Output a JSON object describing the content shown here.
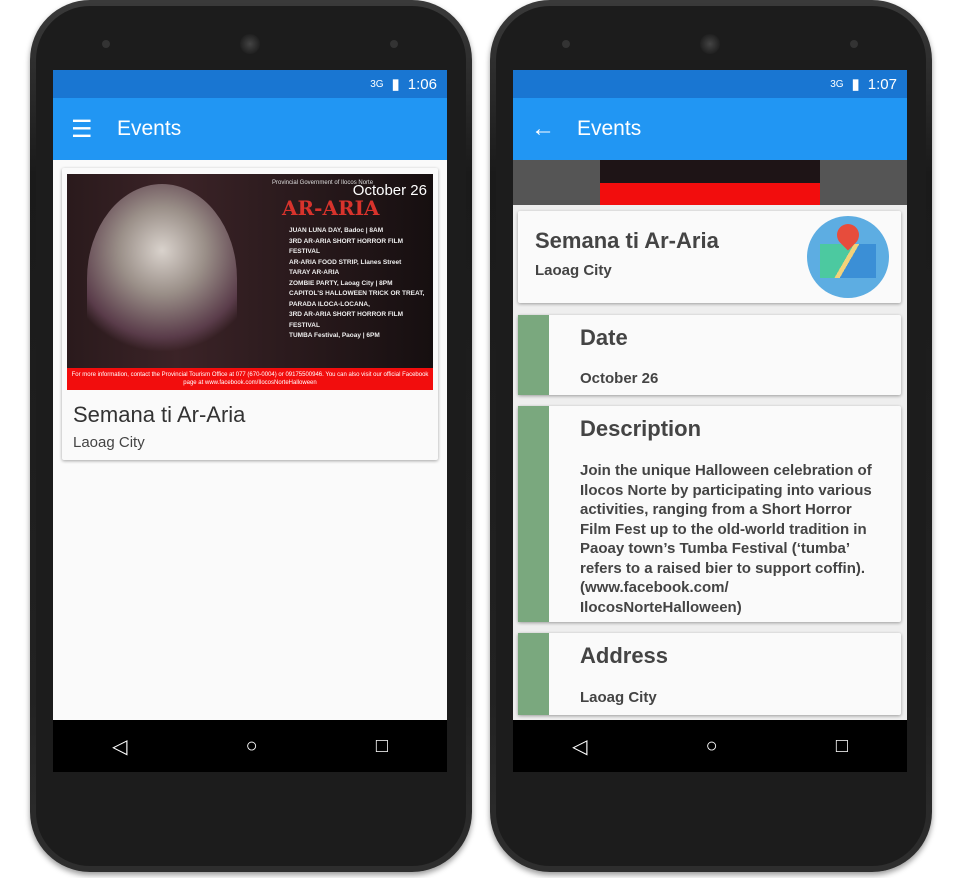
{
  "left": {
    "status": {
      "network": "3G",
      "time": "1:06"
    },
    "toolbar": {
      "title": "Events",
      "nav_icon": "menu-icon"
    },
    "event": {
      "date_overlay": "October 26",
      "title": "Semana ti Ar-Aria",
      "location": "Laoag City"
    }
  },
  "right": {
    "status": {
      "network": "3G",
      "time": "1:07"
    },
    "toolbar": {
      "title": "Events",
      "nav_icon": "back-arrow-icon"
    },
    "header": {
      "title": "Semana ti Ar-Aria",
      "location": "Laoag City"
    },
    "sections": [
      {
        "label": "Date",
        "value": "October 26"
      },
      {
        "label": "Description",
        "value": "Join the unique Halloween celebration of Ilocos Norte by participating into various activities, ranging from a Short Horror Film Fest up to the old-world tradition in Paoay town’s Tumba Festival (‘tumba’ refers to a raised bier to support coffin). (www.facebook.com/ IlocosNorteHalloween)"
      },
      {
        "label": "Address",
        "value": "Laoag City"
      }
    ]
  },
  "poster": {
    "org": "Provincial Government of Ilocos Norte",
    "title": "AR-ARIA",
    "lines": [
      "JUAN LUNA DAY, Badoc | 8AM",
      "3RD AR-ARIA SHORT HORROR FILM FESTIVAL",
      "AR-ARIA FOOD STRIP, Llanes Street",
      "TARAY AR-ARIA",
      "ZOMBIE PARTY, Laoag City | 8PM",
      "CAPITOL'S HALLOWEEN TRICK OR TREAT,",
      "PARADA ILOCA-LOCANA,",
      "3RD AR-ARIA SHORT HORROR FILM FESTIVAL",
      "TUMBA Festival, Paoay | 6PM"
    ],
    "footer": "For more information, contact the Provincial Tourism Office at 077 (670-0004) or 09175500946. You can also visit our official Facebook page at www.facebook.com/IlocosNorteHalloween"
  },
  "nav": {
    "back": "◁",
    "home": "○",
    "recents": "□"
  },
  "colors": {
    "primary": "#2196F3",
    "status": "#1976D2",
    "section_bar": "#7aa87e"
  }
}
